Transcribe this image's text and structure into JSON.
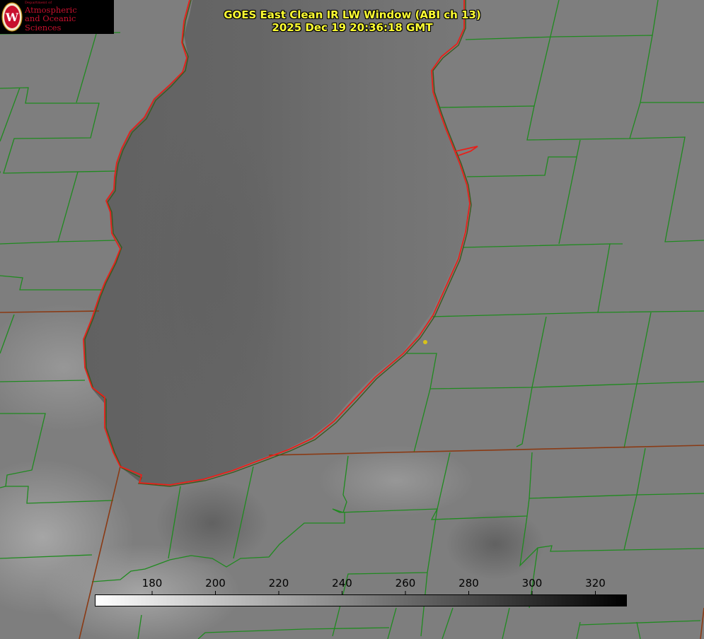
{
  "title": {
    "line1": "GOES East Clean IR LW Window (ABI ch 13)",
    "line2": "2025 Dec 19 20:36:18 GMT"
  },
  "logo": {
    "dept": "Department of",
    "line1": "Atmospheric",
    "line2": "and Oceanic Sciences",
    "seal_letter": "W"
  },
  "colorbar": {
    "ticks": [
      "180",
      "200",
      "220",
      "240",
      "260",
      "280",
      "300",
      "320"
    ],
    "gradient_start": "#ffffff",
    "gradient_end": "#000000"
  },
  "colors": {
    "county_lines": "#1f8a1f",
    "shoreline": "#e8201a",
    "state_lines": "#8a3a14",
    "title": "#ffff33",
    "logo_text": "#c8102e",
    "marker": "#d8c21a"
  }
}
